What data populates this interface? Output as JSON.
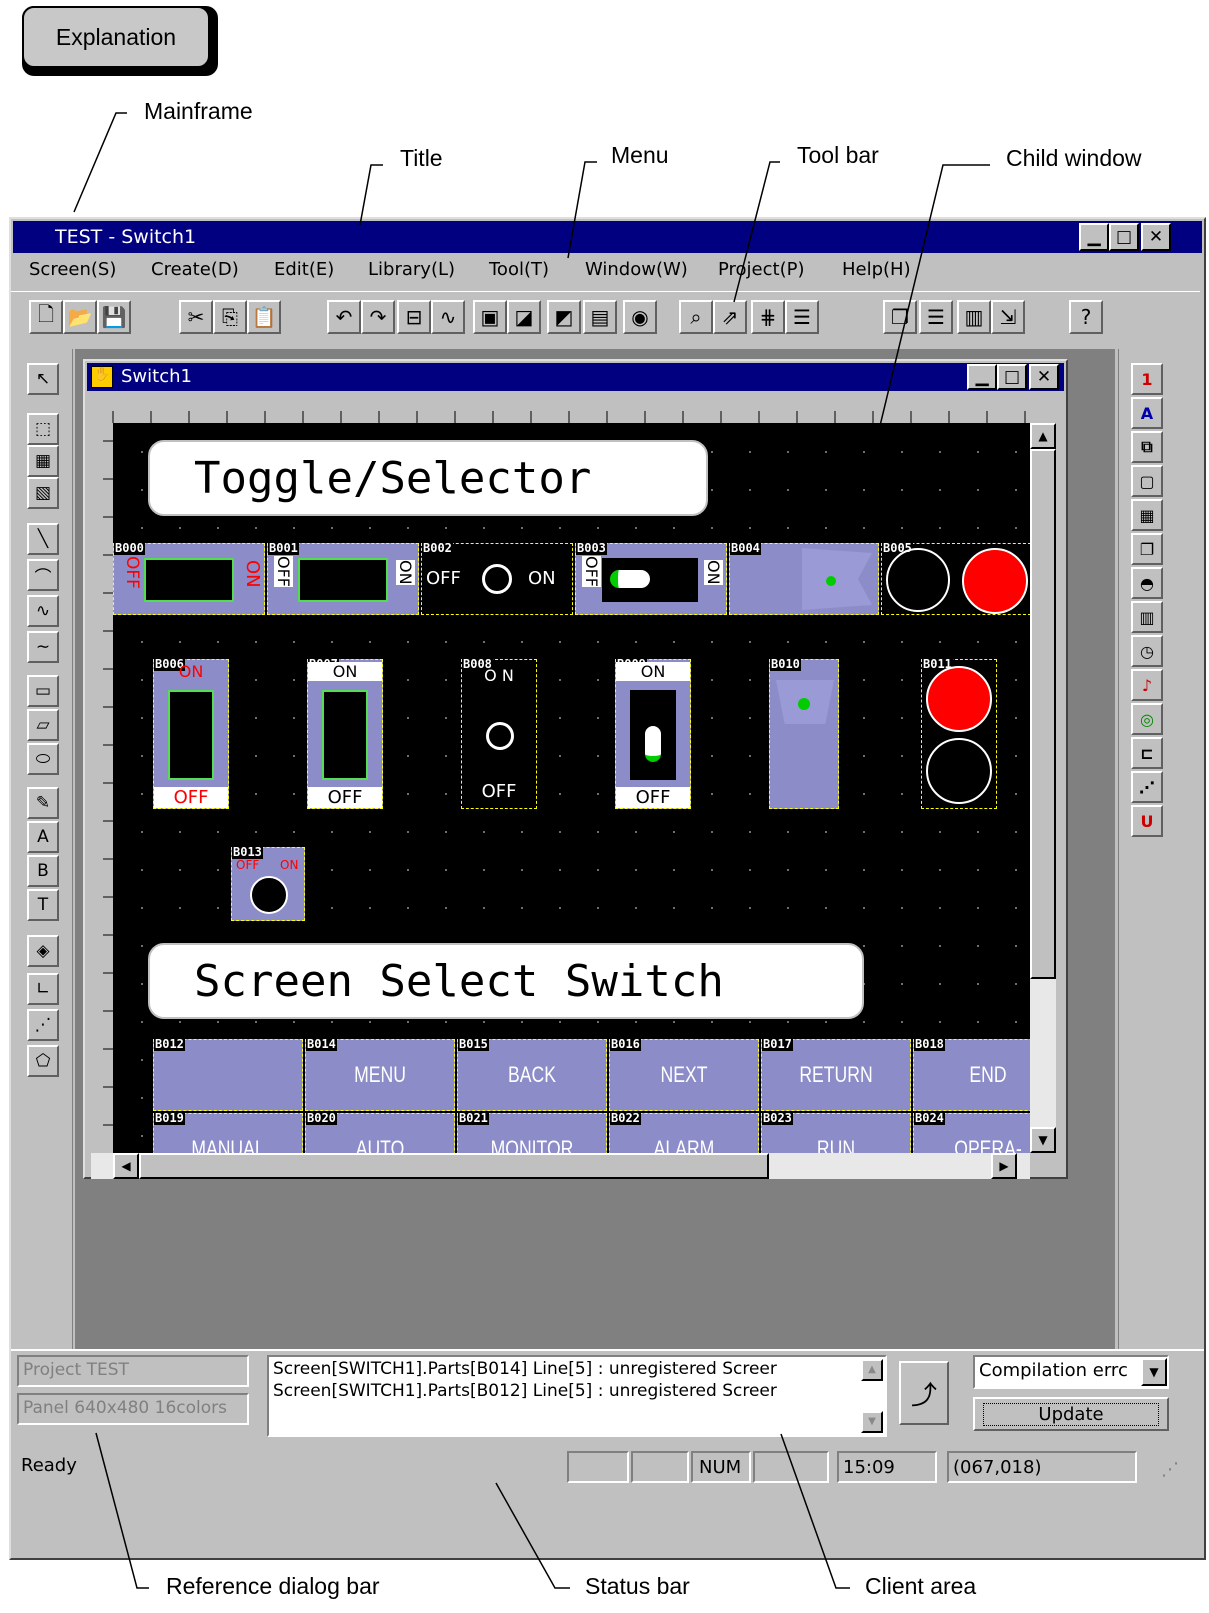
{
  "annotations": {
    "explanation": "Explanation",
    "mainframe": "Mainframe",
    "title": "Title",
    "menu": "Menu",
    "toolbar": "Tool bar",
    "child_window": "Child window",
    "reference_dialog_bar": "Reference dialog bar",
    "status_bar": "Status bar",
    "client_area": "Client area"
  },
  "window": {
    "title": "TEST  - Switch1"
  },
  "menu": [
    "Screen(S)",
    "Create(D)",
    "Edit(E)",
    "Library(L)",
    "Tool(T)",
    "Window(W)",
    "Project(P)",
    "Help(H)"
  ],
  "toolbar": {
    "icons": [
      "new-file-icon",
      "open-folder-icon",
      "save-icon",
      "cut-icon",
      "copy-icon",
      "paste-icon",
      "undo-icon",
      "redo-icon",
      "group-icon",
      "polyline-icon",
      "front-icon",
      "back-icon",
      "forward-icon",
      "library-icon",
      "part-icon",
      "zoom-icon",
      "compile-icon",
      "grid-icon",
      "properties-icon",
      "cascade-icon",
      "tile-horizontal-icon",
      "tile-vertical-icon",
      "arrange-icon",
      "help-icon"
    ]
  },
  "left_tools": [
    "pointer-icon",
    "select-area-icon",
    "select-part-icon",
    "edit-part-icon",
    "line-icon",
    "arc-icon",
    "polyline-icon",
    "curve-icon",
    "rectangle-icon",
    "parallelogram-icon",
    "ellipse-icon",
    "fill-icon",
    "text-icon",
    "bitmap-text-icon",
    "text-box-icon",
    "part-button-icon",
    "axis-icon",
    "graph-icon",
    "polygon-icon"
  ],
  "right_tools": [
    "lamp-icon",
    "text-display-icon",
    "screen-switch-icon",
    "message-icon",
    "numeric-input-icon",
    "window-icon",
    "meter-icon",
    "graph-icon",
    "clock-icon",
    "alarm-icon",
    "ascii-icon",
    "list-icon",
    "trend-icon",
    "user-icon"
  ],
  "child": {
    "title": "Switch1",
    "label_toggle": "Toggle/Selector",
    "label_screen": "Screen Select Switch",
    "parts_top": [
      {
        "id": "B000",
        "on": "ON",
        "off": "OFF"
      },
      {
        "id": "B001",
        "on": "ON",
        "off": "OFF"
      },
      {
        "id": "B002",
        "on": "ON",
        "off": "OFF"
      },
      {
        "id": "B003",
        "on": "ON",
        "off": "OFF"
      },
      {
        "id": "B004"
      },
      {
        "id": "B005"
      }
    ],
    "parts_mid": [
      {
        "id": "B006",
        "on": "ON",
        "off": "OFF"
      },
      {
        "id": "B007",
        "on": "ON",
        "off": "OFF"
      },
      {
        "id": "B008",
        "on": "O N",
        "off": "OFF"
      },
      {
        "id": "B009",
        "on": "ON",
        "off": "OFF"
      },
      {
        "id": "B010"
      },
      {
        "id": "B011"
      }
    ],
    "part_b013": {
      "id": "B013",
      "off": "OFF",
      "on": "ON"
    },
    "buttons_row1": [
      {
        "id": "B012",
        "label": ""
      },
      {
        "id": "B014",
        "label": "MENU"
      },
      {
        "id": "B015",
        "label": "BACK"
      },
      {
        "id": "B016",
        "label": "NEXT"
      },
      {
        "id": "B017",
        "label": "RETURN"
      },
      {
        "id": "B018",
        "label": "END"
      }
    ],
    "buttons_row2": [
      {
        "id": "B019",
        "label": "MANUAL"
      },
      {
        "id": "B020",
        "label": "AUTO"
      },
      {
        "id": "B021",
        "label": "MONITOR"
      },
      {
        "id": "B022",
        "label": "ALARM"
      },
      {
        "id": "B023",
        "label": "RUN"
      },
      {
        "id": "B024",
        "label": "OPERA-"
      }
    ]
  },
  "reference": {
    "project": "Project TEST",
    "panel": "Panel 640x480 16colors",
    "messages": [
      "Screen[SWITCH1].Parts[B014] Line[5] : unregistered Screer",
      "Screen[SWITCH1].Parts[B012] Line[5] : unregistered Screer"
    ],
    "dropdown": "Compilation errc",
    "update": "Update"
  },
  "status": {
    "text": "Ready",
    "num": "NUM",
    "time": "15:09",
    "coords": "(067,018)"
  }
}
